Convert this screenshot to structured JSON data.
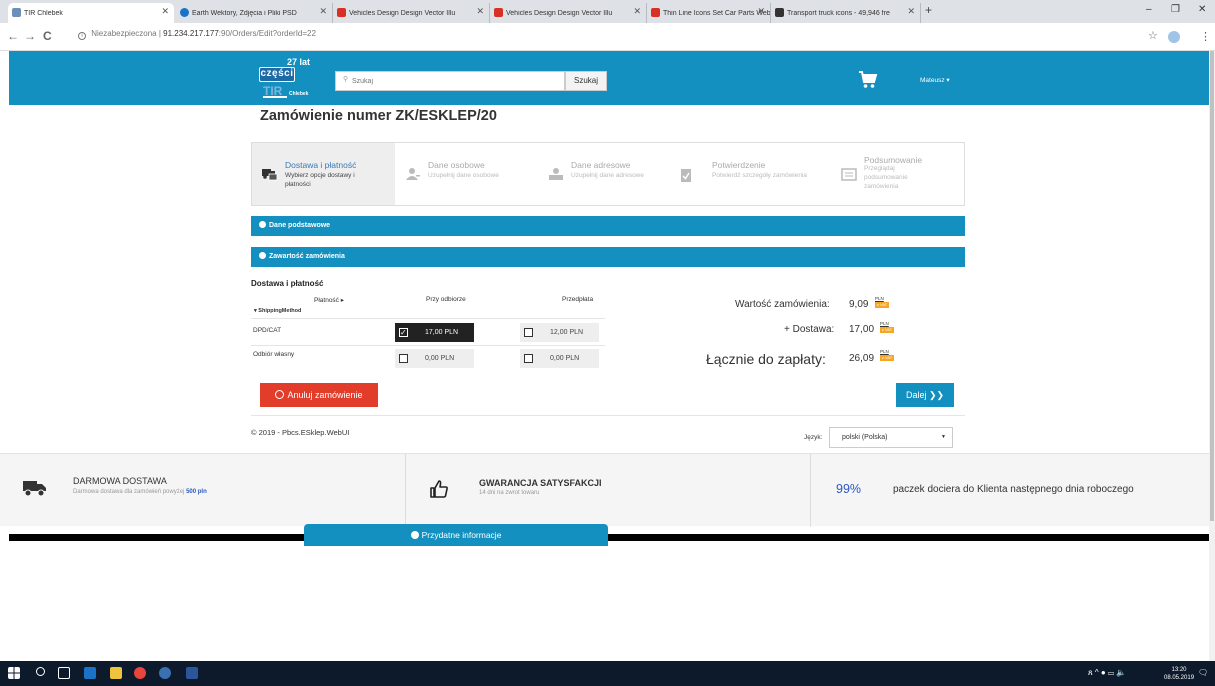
{
  "browser": {
    "tabs": [
      {
        "label": "TIR Chlebek",
        "color": "#6b8fb8",
        "active": true
      },
      {
        "label": "Earth Wektory, Zdjęcia i Pliki PSD",
        "color": "#1a73c8"
      },
      {
        "label": "Vehicles Design Design Vector Illu",
        "color": "#d93025"
      },
      {
        "label": "Vehicles Design Design Vector Illu",
        "color": "#d93025"
      },
      {
        "label": "Thin Line Icons Set Car Parts Web",
        "color": "#d93025"
      },
      {
        "label": "Transport truck icons - 49,946 fre",
        "color": "#333333"
      }
    ],
    "new_tab": "+",
    "minimize": "–",
    "maximize": "❐",
    "close": "✕",
    "back": "←",
    "forward": "→",
    "reload": "C",
    "url_security": "Niezabezpieczona",
    "url_host": "91.234.217.177",
    "url_path": ":90/Orders/Edit?orderId=22",
    "url_separator": "|",
    "star": "☆",
    "menu": "⋮"
  },
  "header": {
    "logo_years": "27 lat",
    "logo_line1": "części",
    "logo_line2": "TIR",
    "logo_line3": "Chlebek",
    "search_placeholder": "Szukaj",
    "search_button": "Szukaj",
    "user_name": "Mateusz ▾",
    "brand_color": "#1390bf"
  },
  "order": {
    "title": "Zamówienie numer ZK/ESKLEP/20",
    "steps": [
      {
        "title": "Dostawa i płatność",
        "desc": "Wybierz opcje dostawy i płatności",
        "icon": "truck-payment-icon",
        "active": true
      },
      {
        "title": "Dane osobowe",
        "desc": "Uzupełnij dane osobowe",
        "icon": "user-icon"
      },
      {
        "title": "Dane adresowe",
        "desc": "Uzupełnij dane adresowe",
        "icon": "address-icon"
      },
      {
        "title": "Potwierdzenie",
        "desc": "Potwierdź szczegóły zamówienia",
        "icon": "check-clipboard-icon"
      },
      {
        "title": "Podsumowanie",
        "desc": "Przeglądaj podsumowanie zamówienia",
        "icon": "summary-icon"
      }
    ],
    "section_basic": "Dane podstawowe",
    "section_contents": "Zawartość zamówienia"
  },
  "delivery": {
    "title": "Dostawa i płatność",
    "col_payment": "Płatność ▸",
    "col_cod": "Przy odbiorze",
    "col_prepaid": "Przedpłata",
    "shipping_method_label": "▾ ShippingMethod",
    "rows": [
      {
        "method": "DPD/CAT",
        "cod": "17,00 PLN",
        "prepaid": "12,00 PLN",
        "cod_selected": true
      },
      {
        "method": "Odbiór własny",
        "cod": "0,00 PLN",
        "prepaid": "0,00 PLN",
        "cod_selected": false
      }
    ]
  },
  "summary": {
    "order_value_label": "Wartość zamówienia:",
    "order_value": "9,09",
    "delivery_label": "+ Dostawa:",
    "delivery_value": "17,00",
    "total_label": "Łącznie do zapłaty:",
    "total_value": "26,09",
    "currency": "PLN",
    "vat_badge": "z VAT"
  },
  "actions": {
    "cancel": "Anuluj zamówienie",
    "next": "Dalej ❯❯"
  },
  "footer": {
    "copyright": "© 2019 - Pbcs.ESklep.WebUI",
    "lang_label": "Język:",
    "lang_value": "polski (Polska)",
    "lang_caret": "▼"
  },
  "features": {
    "free_delivery_title": "DARMOWA DOSTAWA",
    "free_delivery_sub": "Darmowa dostawa dla zamówień powyżej ",
    "free_delivery_amount": "500 pln",
    "guarantee_title": "GWARANCJA SATYSFAKCJI",
    "guarantee_sub": "14 dni na zwrot towaru",
    "pct": "99%",
    "pct_text": "paczek dociera do Klienta następnego dnia roboczego",
    "info_tab": "Przydatne informacje"
  },
  "taskbar": {
    "time": "13:20",
    "date": "08.05.2019",
    "tray_icons": "ጸ  ^  ●  ▭  🔈",
    "notification": "🗨"
  }
}
